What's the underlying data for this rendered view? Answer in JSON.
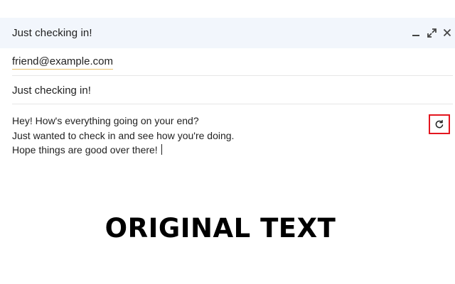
{
  "compose": {
    "title": "Just checking in!",
    "controls": {
      "minimize_icon": "minimize-icon",
      "expand_icon": "expand-icon",
      "close_icon": "close-icon"
    },
    "to": "friend@example.com",
    "subject": "Just checking in!",
    "body_lines": [
      "Hey! How's everything going on your end?",
      "Just wanted to check in and see how you're doing.",
      "Hope things are good over there!"
    ],
    "refresh_button": {
      "icon": "refresh-icon",
      "border_color": "#e3161f"
    }
  },
  "label": "ORIGINAL TEXT",
  "colors": {
    "titlebar_bg": "#f2f6fc",
    "to_underline": "#e8c26a"
  }
}
